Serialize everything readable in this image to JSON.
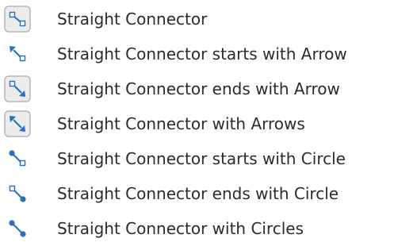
{
  "menu": {
    "items": [
      {
        "label": "Straight Connector",
        "icon": "straight-connector-icon"
      },
      {
        "label": "Straight Connector starts with Arrow",
        "icon": "straight-connector-starts-arrow-icon"
      },
      {
        "label": "Straight Connector ends with Arrow",
        "icon": "straight-connector-ends-arrow-icon"
      },
      {
        "label": "Straight Connector with Arrows",
        "icon": "straight-connector-arrows-icon"
      },
      {
        "label": "Straight Connector starts with Circle",
        "icon": "straight-connector-starts-circle-icon"
      },
      {
        "label": "Straight Connector ends with Circle",
        "icon": "straight-connector-ends-circle-icon"
      },
      {
        "label": "Straight Connector with Circles",
        "icon": "straight-connector-circles-icon"
      }
    ]
  },
  "colors": {
    "text": "#2b2b2b",
    "icon_blue": "#2a6fbe",
    "selected_frame": "#b7b7b7",
    "selected_fill": "#ececec"
  }
}
